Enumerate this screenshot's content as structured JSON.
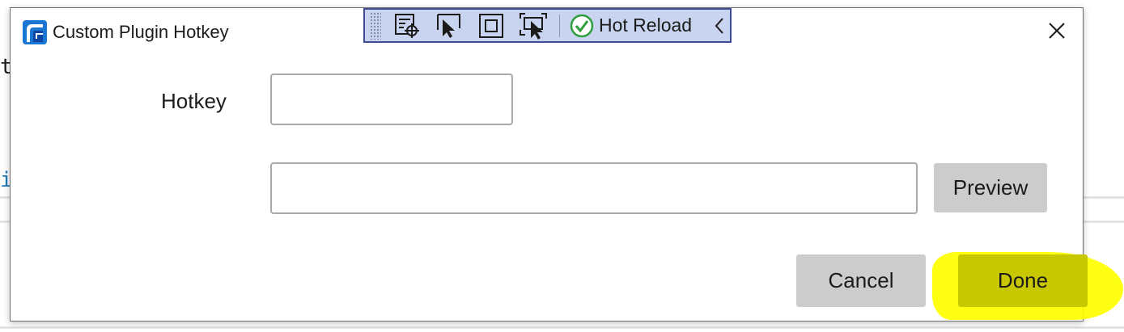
{
  "window": {
    "title": "Custom Plugin Hotkey"
  },
  "background": {
    "char_t": "t",
    "char_i": "i"
  },
  "toolbar": {
    "hot_reload_label": "Hot Reload",
    "icons": [
      "grip-icon",
      "select-element-icon",
      "select-pointer-icon",
      "layout-adorner-icon",
      "track-focus-icon",
      "hot-reload-check-icon",
      "chevron-left-icon"
    ]
  },
  "form": {
    "hotkey_label": "Hotkey",
    "hotkey_value": "",
    "preview_value": ""
  },
  "buttons": {
    "preview_label": "Preview",
    "cancel_label": "Cancel",
    "done_label": "Done"
  },
  "colors": {
    "toolbar_bg": "#c9d5f0",
    "toolbar_border": "#3e4c93",
    "button_bg": "#cccccc",
    "highlight": "#ffff00",
    "hot_reload_check": "#2e9e3e"
  }
}
